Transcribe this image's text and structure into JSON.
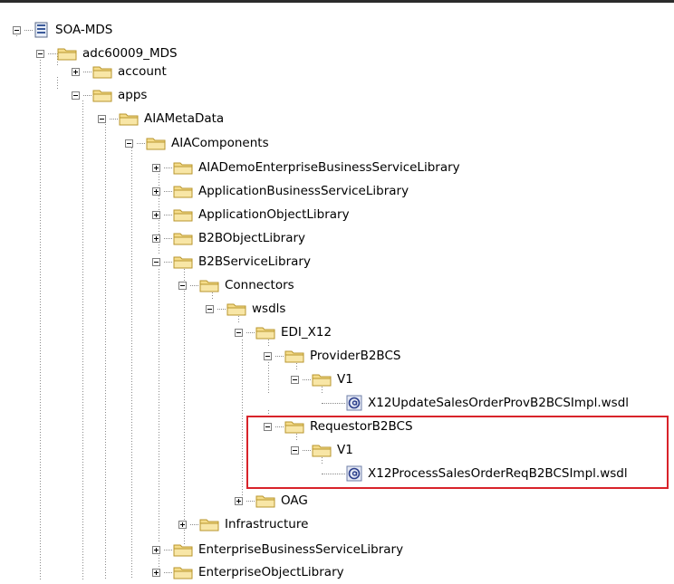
{
  "tree": {
    "nodes": [
      {
        "label": "SOA-MDS",
        "icon": "database-icon",
        "expanded": true
      },
      {
        "label": "adc60009_MDS",
        "icon": "folder-icon",
        "expanded": true
      },
      {
        "label": "account",
        "icon": "folder-icon",
        "expanded": false
      },
      {
        "label": "apps",
        "icon": "folder-icon",
        "expanded": true
      },
      {
        "label": "AIAMetaData",
        "icon": "folder-icon",
        "expanded": true
      },
      {
        "label": "AIAComponents",
        "icon": "folder-icon",
        "expanded": true
      },
      {
        "label": "AIADemoEnterpriseBusinessServiceLibrary",
        "icon": "folder-icon",
        "expanded": false
      },
      {
        "label": "ApplicationBusinessServiceLibrary",
        "icon": "folder-icon",
        "expanded": false
      },
      {
        "label": "ApplicationObjectLibrary",
        "icon": "folder-icon",
        "expanded": false
      },
      {
        "label": "B2BObjectLibrary",
        "icon": "folder-icon",
        "expanded": false
      },
      {
        "label": "B2BServiceLibrary",
        "icon": "folder-icon",
        "expanded": true
      },
      {
        "label": "Connectors",
        "icon": "folder-icon",
        "expanded": true
      },
      {
        "label": "wsdls",
        "icon": "folder-icon",
        "expanded": true
      },
      {
        "label": "EDI_X12",
        "icon": "folder-icon",
        "expanded": true
      },
      {
        "label": "ProviderB2BCS",
        "icon": "folder-icon",
        "expanded": true
      },
      {
        "label": "V1",
        "icon": "folder-icon",
        "expanded": true
      },
      {
        "label": "X12UpdateSalesOrderProvB2BCSImpl.wsdl",
        "icon": "wsdl-file-icon"
      },
      {
        "label": "RequestorB2BCS",
        "icon": "folder-icon",
        "expanded": true
      },
      {
        "label": "V1",
        "icon": "folder-icon",
        "expanded": true
      },
      {
        "label": "X12ProcessSalesOrderReqB2BCSImpl.wsdl",
        "icon": "wsdl-file-icon"
      },
      {
        "label": "OAG",
        "icon": "folder-icon",
        "expanded": false
      },
      {
        "label": "Infrastructure",
        "icon": "folder-icon",
        "expanded": false
      },
      {
        "label": "EnterpriseBusinessServiceLibrary",
        "icon": "folder-icon",
        "expanded": false
      },
      {
        "label": "EnterpriseObjectLibrary",
        "icon": "folder-icon",
        "expanded": false
      }
    ]
  },
  "colors": {
    "highlight_border": "#d8232a",
    "folder_fill": "#f5dc8a",
    "guide_line": "#8a8a8a"
  }
}
